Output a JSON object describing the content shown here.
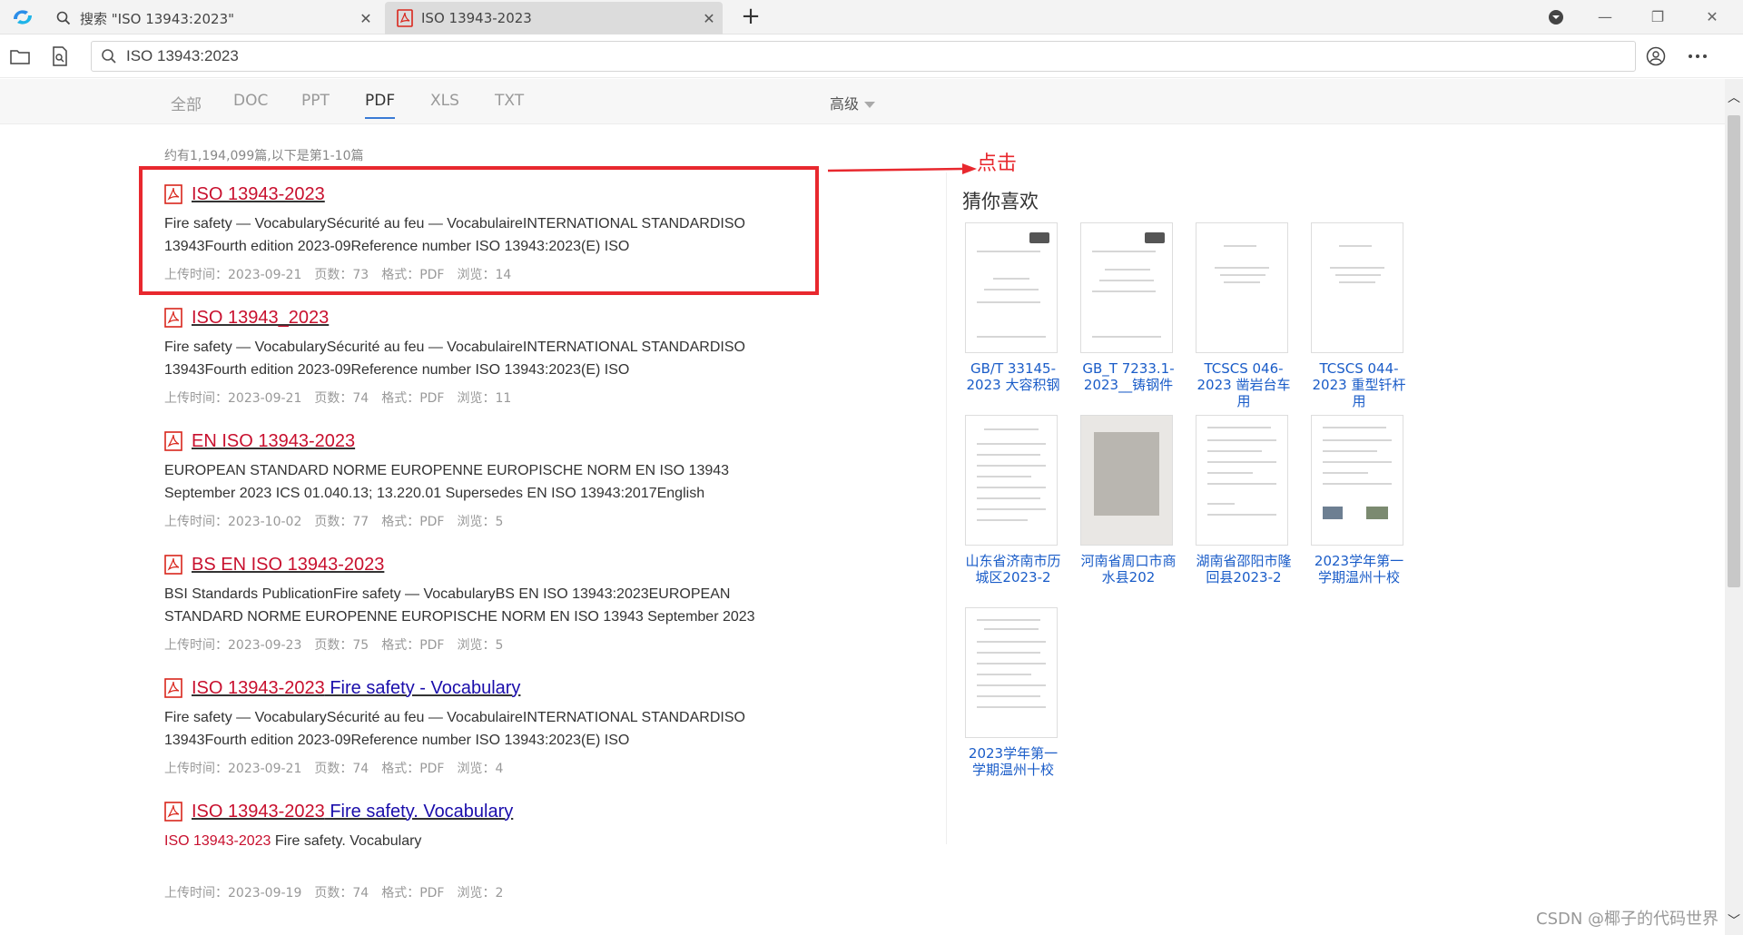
{
  "tabs": [
    {
      "label": "搜索 \"ISO 13943:2023\"",
      "icon": "search-icon",
      "close": "✕"
    },
    {
      "label": "ISO 13943-2023",
      "icon": "pdf-icon",
      "close": "✕"
    }
  ],
  "new_tab": "+",
  "window": {
    "download": "⬇",
    "minimize": "—",
    "restore": "❐",
    "close": "✕"
  },
  "search": {
    "value": "ISO 13943:2023"
  },
  "filters": [
    {
      "label": "全部",
      "active": false
    },
    {
      "label": "DOC",
      "active": false
    },
    {
      "label": "PPT",
      "active": false
    },
    {
      "label": "PDF",
      "active": true
    },
    {
      "label": "XLS",
      "active": false
    },
    {
      "label": "TXT",
      "active": false
    }
  ],
  "advanced": {
    "label": "高级"
  },
  "result_count": "约有1,194,099篇,以下是第1-10篇",
  "results": [
    {
      "title_red": "ISO 13943-2023",
      "title_blue": "",
      "snippet_hl": "",
      "snippet": "Fire safety — VocabularySécurité au feu — VocabulaireINTERNATIONAL STANDARDISO 13943Fourth edition 2023-09Reference number ISO 13943:2023(E) ISO",
      "uploaded": "上传时间：2023-09-21",
      "pages": "页数：73",
      "format": "格式：PDF",
      "views": "浏览：14"
    },
    {
      "title_red": "ISO 13943_2023",
      "title_blue": "",
      "snippet_hl": "",
      "snippet": "Fire safety — VocabularySécurité au feu — VocabulaireINTERNATIONAL STANDARDISO 13943Fourth edition 2023-09Reference number ISO 13943:2023(E) ISO",
      "uploaded": "上传时间：2023-09-21",
      "pages": "页数：74",
      "format": "格式：PDF",
      "views": "浏览：11"
    },
    {
      "title_red": "EN ISO 13943-2023",
      "title_blue": "",
      "snippet_hl": "",
      "snippet": "EUROPEAN STANDARD NORME EUROPENNE EUROPISCHE NORM EN ISO 13943 September 2023 ICS 01.040.13; 13.220.01 Supersedes EN ISO 13943:2017English",
      "uploaded": "上传时间：2023-10-02",
      "pages": "页数：77",
      "format": "格式：PDF",
      "views": "浏览：5"
    },
    {
      "title_red": "BS EN ISO 13943-2023",
      "title_blue": "",
      "snippet_hl": "",
      "snippet": "BSI Standards PublicationFire safety — VocabularyBS EN ISO 13943:2023EUROPEAN STANDARD NORME EUROPENNE EUROPISCHE NORM EN ISO 13943 September 2023",
      "uploaded": "上传时间：2023-09-23",
      "pages": "页数：75",
      "format": "格式：PDF",
      "views": "浏览：5"
    },
    {
      "title_red": "ISO 13943-2023",
      "title_blue": " Fire safety - Vocabulary",
      "snippet_hl": "",
      "snippet": "Fire safety — VocabularySécurité au feu — VocabulaireINTERNATIONAL STANDARDISO 13943Fourth edition 2023-09Reference number ISO 13943:2023(E) ISO",
      "uploaded": "上传时间：2023-09-21",
      "pages": "页数：74",
      "format": "格式：PDF",
      "views": "浏览：4"
    },
    {
      "title_red": "ISO 13943-2023",
      "title_blue": " Fire safety. Vocabulary",
      "snippet_hl": "ISO 13943-2023",
      "snippet": " Fire safety. Vocabulary",
      "uploaded": "上传时间：2023-09-19",
      "pages": "页数：74",
      "format": "格式：PDF",
      "views": "浏览：2"
    }
  ],
  "annotation": {
    "label": "点击"
  },
  "recommendations": {
    "title": "猜你喜欢",
    "items": [
      {
        "caption": "GB/T 33145-2023 大容积钢"
      },
      {
        "caption": "GB_T 7233.1-2023__铸钢件"
      },
      {
        "caption": "TCSCS 046-2023 凿岩台车用"
      },
      {
        "caption": "TCSCS 044-2023 重型钎杆用"
      },
      {
        "caption": "山东省济南市历城区2023-2"
      },
      {
        "caption": "河南省周口市商水县202"
      },
      {
        "caption": "湖南省邵阳市隆回县2023-2"
      },
      {
        "caption": "2023学年第一学期温州十校"
      },
      {
        "caption": "2023学年第一学期温州十校"
      }
    ]
  },
  "watermark": "CSDN @椰子的代码世界",
  "colors": {
    "title_red": "#c8102e",
    "title_blue": "#1a0dab",
    "annotation": "#e8282e",
    "accent": "#3a7bd5",
    "rec_link": "#1a5cc8"
  }
}
